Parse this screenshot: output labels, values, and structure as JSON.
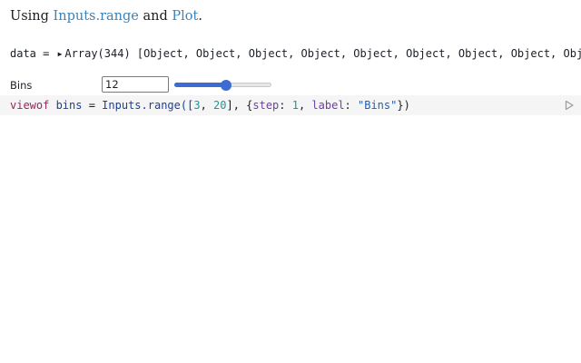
{
  "intro": {
    "prefix": "Using ",
    "link1": "Inputs.range",
    "middle": " and ",
    "link2": "Plot",
    "suffix": "."
  },
  "data_line": {
    "name": "data",
    "op": " = ",
    "type": "Array(344)",
    "preview": " [Object, Object, Object, Object, Object, Object, Object, Object, Object, Obje"
  },
  "range": {
    "label": "Bins",
    "value": "12",
    "min": 3,
    "max": 20,
    "step": 1,
    "fill_fraction": 0.53
  },
  "code": {
    "keyword": "viewof",
    "var": " bins",
    "eq": " = ",
    "call": "Inputs.range([",
    "num1": "3",
    "comma1": ", ",
    "num2": "20",
    "close1": "], {",
    "prop1": "step",
    "colon1": ": ",
    "num3": "1",
    "comma2": ", ",
    "prop2": "label",
    "colon2": ": ",
    "str1": "\"Bins\"",
    "close2": "})"
  },
  "colors": {
    "accent": "#3c6bd3",
    "link": "#3b82b8",
    "cell_bg": "#f5f5f5"
  },
  "icons": {
    "caret": "triangle-right-icon",
    "run": "play-icon"
  }
}
